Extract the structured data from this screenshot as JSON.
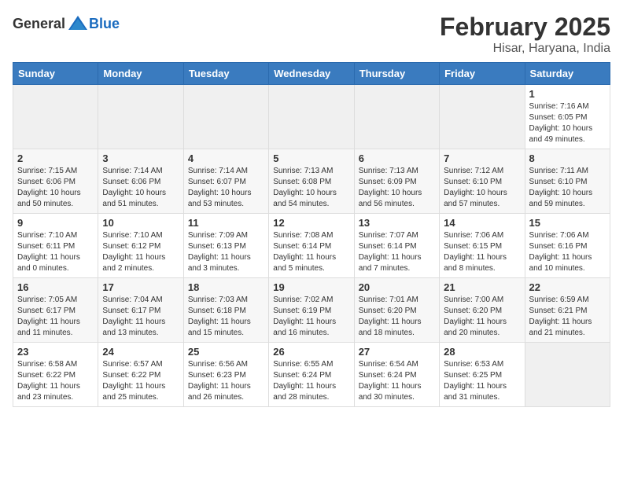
{
  "header": {
    "logo_general": "General",
    "logo_blue": "Blue",
    "title": "February 2025",
    "subtitle": "Hisar, Haryana, India"
  },
  "days_of_week": [
    "Sunday",
    "Monday",
    "Tuesday",
    "Wednesday",
    "Thursday",
    "Friday",
    "Saturday"
  ],
  "weeks": [
    [
      {
        "day": "",
        "info": ""
      },
      {
        "day": "",
        "info": ""
      },
      {
        "day": "",
        "info": ""
      },
      {
        "day": "",
        "info": ""
      },
      {
        "day": "",
        "info": ""
      },
      {
        "day": "",
        "info": ""
      },
      {
        "day": "1",
        "info": "Sunrise: 7:16 AM\nSunset: 6:05 PM\nDaylight: 10 hours and 49 minutes."
      }
    ],
    [
      {
        "day": "2",
        "info": "Sunrise: 7:15 AM\nSunset: 6:06 PM\nDaylight: 10 hours and 50 minutes."
      },
      {
        "day": "3",
        "info": "Sunrise: 7:14 AM\nSunset: 6:06 PM\nDaylight: 10 hours and 51 minutes."
      },
      {
        "day": "4",
        "info": "Sunrise: 7:14 AM\nSunset: 6:07 PM\nDaylight: 10 hours and 53 minutes."
      },
      {
        "day": "5",
        "info": "Sunrise: 7:13 AM\nSunset: 6:08 PM\nDaylight: 10 hours and 54 minutes."
      },
      {
        "day": "6",
        "info": "Sunrise: 7:13 AM\nSunset: 6:09 PM\nDaylight: 10 hours and 56 minutes."
      },
      {
        "day": "7",
        "info": "Sunrise: 7:12 AM\nSunset: 6:10 PM\nDaylight: 10 hours and 57 minutes."
      },
      {
        "day": "8",
        "info": "Sunrise: 7:11 AM\nSunset: 6:10 PM\nDaylight: 10 hours and 59 minutes."
      }
    ],
    [
      {
        "day": "9",
        "info": "Sunrise: 7:10 AM\nSunset: 6:11 PM\nDaylight: 11 hours and 0 minutes."
      },
      {
        "day": "10",
        "info": "Sunrise: 7:10 AM\nSunset: 6:12 PM\nDaylight: 11 hours and 2 minutes."
      },
      {
        "day": "11",
        "info": "Sunrise: 7:09 AM\nSunset: 6:13 PM\nDaylight: 11 hours and 3 minutes."
      },
      {
        "day": "12",
        "info": "Sunrise: 7:08 AM\nSunset: 6:14 PM\nDaylight: 11 hours and 5 minutes."
      },
      {
        "day": "13",
        "info": "Sunrise: 7:07 AM\nSunset: 6:14 PM\nDaylight: 11 hours and 7 minutes."
      },
      {
        "day": "14",
        "info": "Sunrise: 7:06 AM\nSunset: 6:15 PM\nDaylight: 11 hours and 8 minutes."
      },
      {
        "day": "15",
        "info": "Sunrise: 7:06 AM\nSunset: 6:16 PM\nDaylight: 11 hours and 10 minutes."
      }
    ],
    [
      {
        "day": "16",
        "info": "Sunrise: 7:05 AM\nSunset: 6:17 PM\nDaylight: 11 hours and 11 minutes."
      },
      {
        "day": "17",
        "info": "Sunrise: 7:04 AM\nSunset: 6:17 PM\nDaylight: 11 hours and 13 minutes."
      },
      {
        "day": "18",
        "info": "Sunrise: 7:03 AM\nSunset: 6:18 PM\nDaylight: 11 hours and 15 minutes."
      },
      {
        "day": "19",
        "info": "Sunrise: 7:02 AM\nSunset: 6:19 PM\nDaylight: 11 hours and 16 minutes."
      },
      {
        "day": "20",
        "info": "Sunrise: 7:01 AM\nSunset: 6:20 PM\nDaylight: 11 hours and 18 minutes."
      },
      {
        "day": "21",
        "info": "Sunrise: 7:00 AM\nSunset: 6:20 PM\nDaylight: 11 hours and 20 minutes."
      },
      {
        "day": "22",
        "info": "Sunrise: 6:59 AM\nSunset: 6:21 PM\nDaylight: 11 hours and 21 minutes."
      }
    ],
    [
      {
        "day": "23",
        "info": "Sunrise: 6:58 AM\nSunset: 6:22 PM\nDaylight: 11 hours and 23 minutes."
      },
      {
        "day": "24",
        "info": "Sunrise: 6:57 AM\nSunset: 6:22 PM\nDaylight: 11 hours and 25 minutes."
      },
      {
        "day": "25",
        "info": "Sunrise: 6:56 AM\nSunset: 6:23 PM\nDaylight: 11 hours and 26 minutes."
      },
      {
        "day": "26",
        "info": "Sunrise: 6:55 AM\nSunset: 6:24 PM\nDaylight: 11 hours and 28 minutes."
      },
      {
        "day": "27",
        "info": "Sunrise: 6:54 AM\nSunset: 6:24 PM\nDaylight: 11 hours and 30 minutes."
      },
      {
        "day": "28",
        "info": "Sunrise: 6:53 AM\nSunset: 6:25 PM\nDaylight: 11 hours and 31 minutes."
      },
      {
        "day": "",
        "info": ""
      }
    ]
  ]
}
